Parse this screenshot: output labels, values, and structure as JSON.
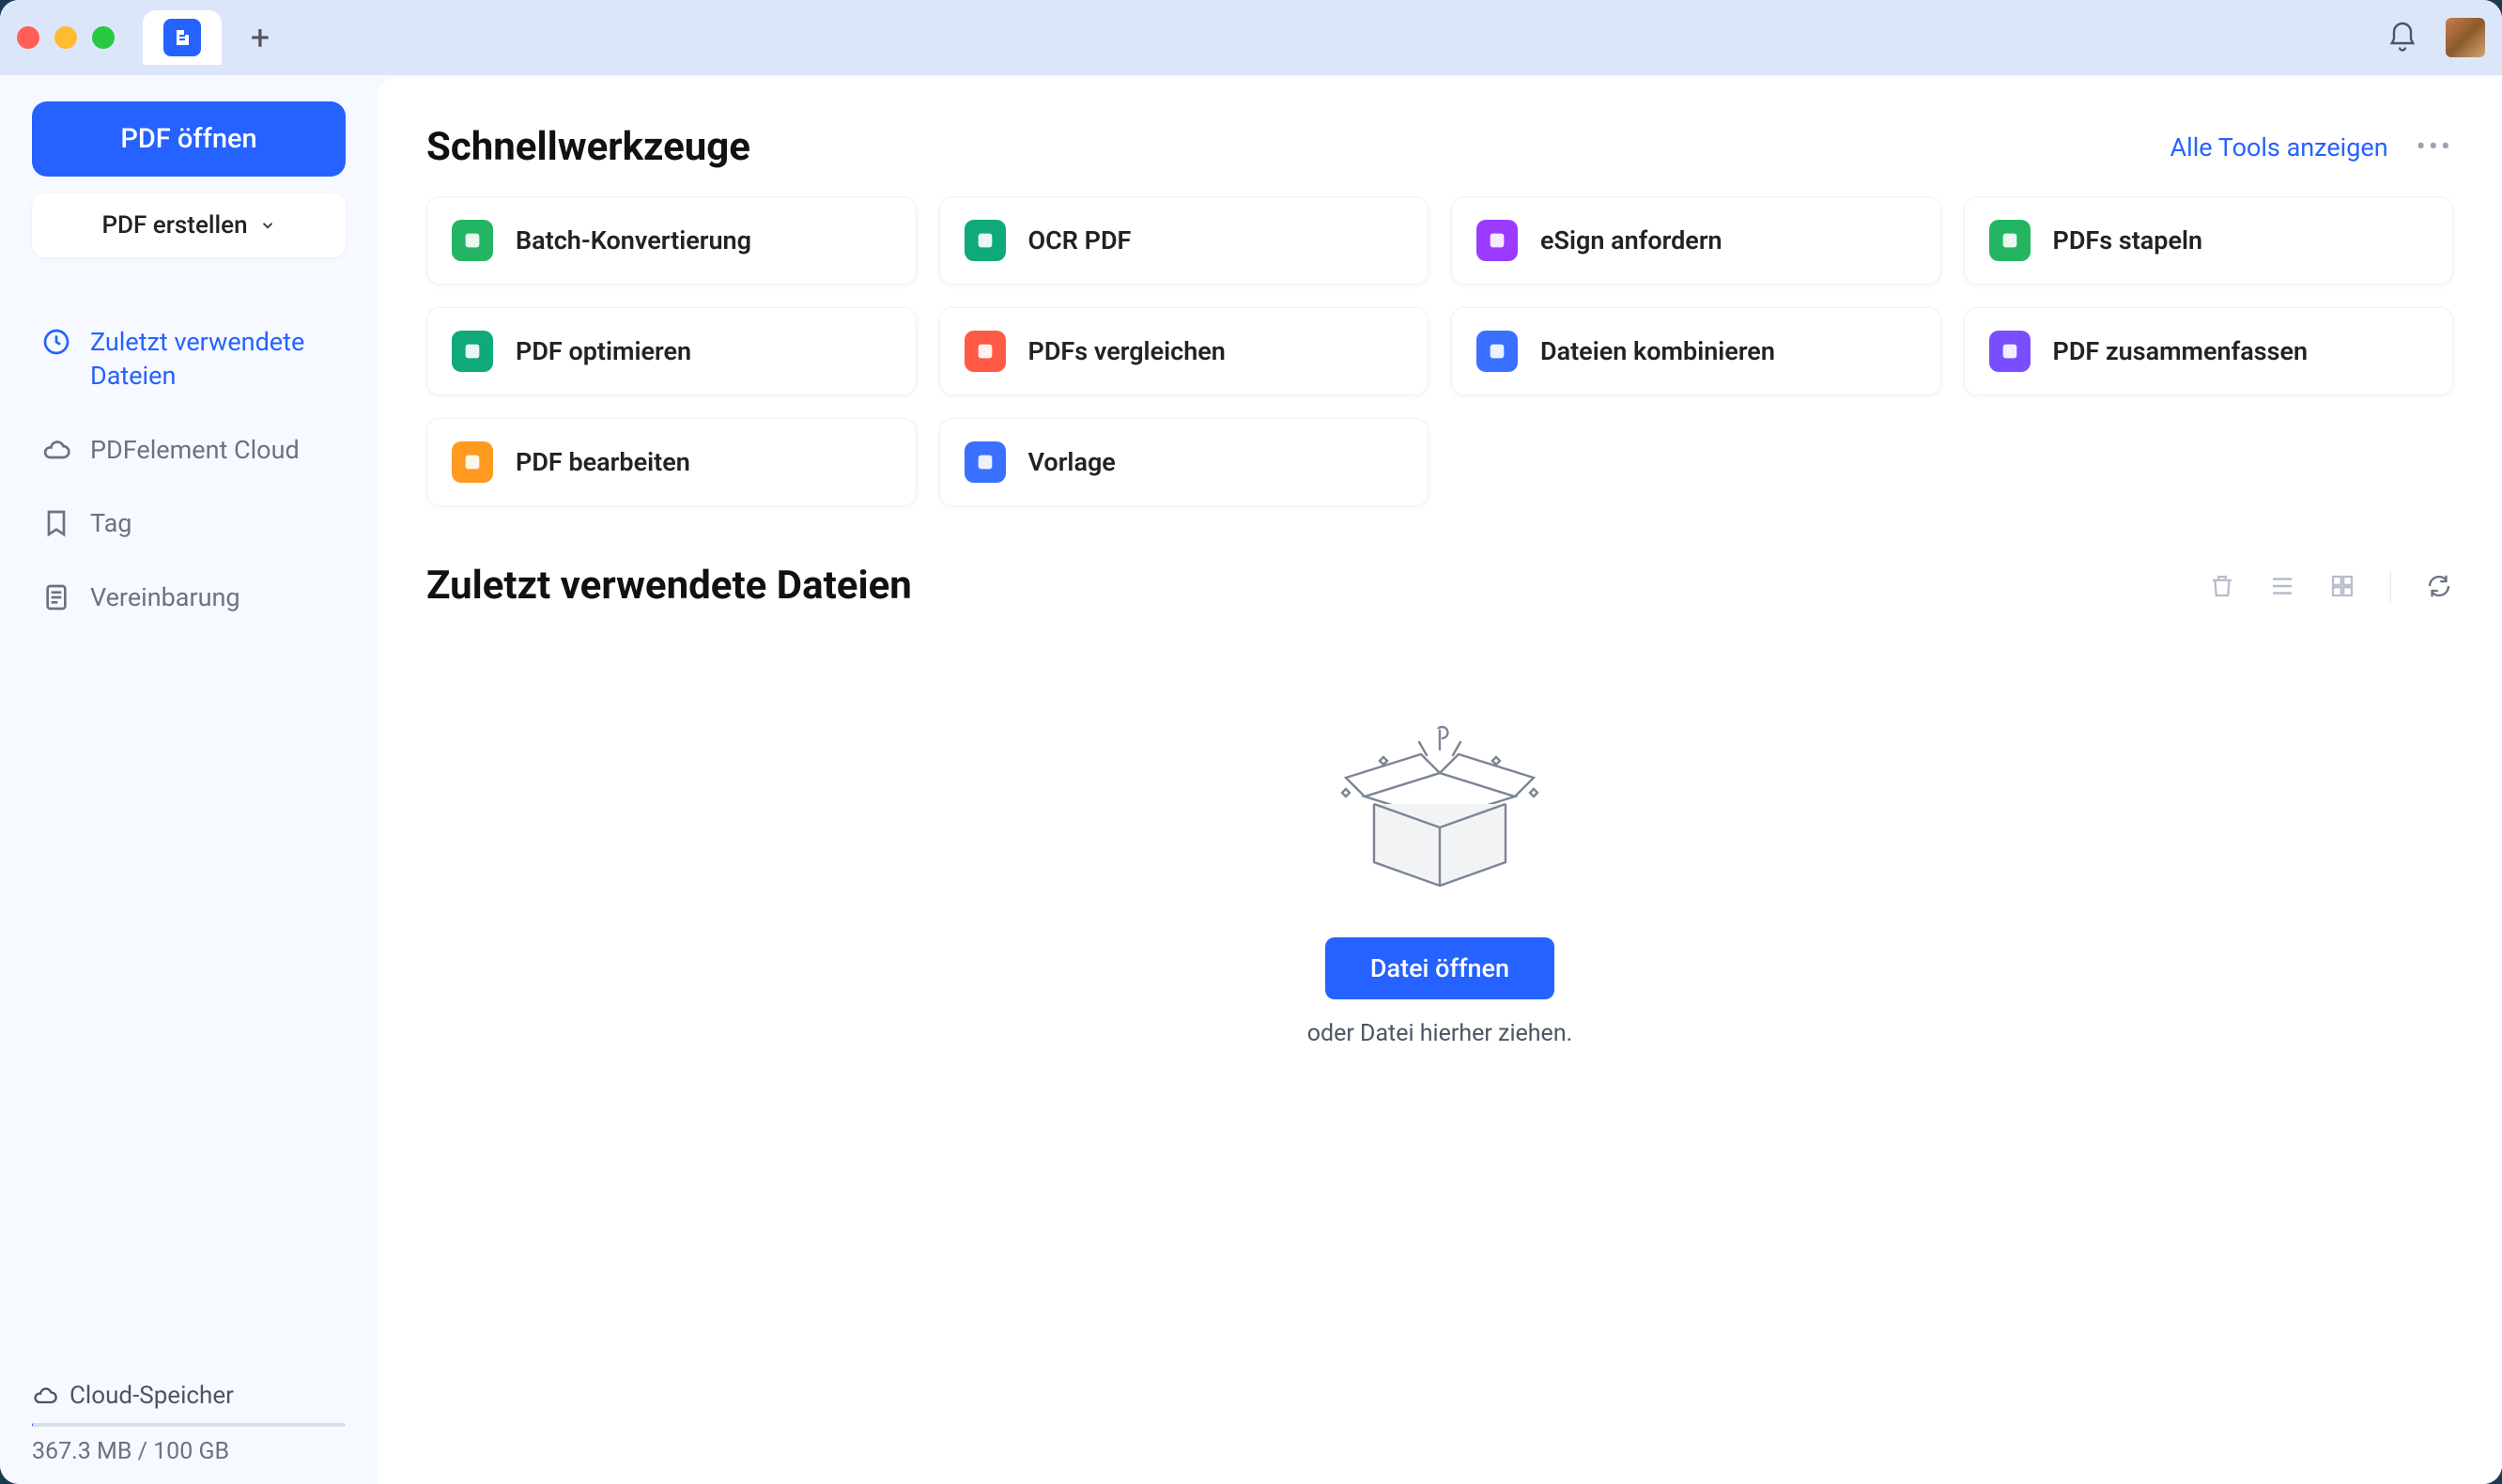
{
  "sidebar": {
    "open_label": "PDF öffnen",
    "create_label": "PDF erstellen",
    "nav": [
      {
        "label": "Zuletzt verwendete Dateien",
        "icon": "clock-icon",
        "active": true
      },
      {
        "label": "PDFelement Cloud",
        "icon": "cloud-icon",
        "active": false
      },
      {
        "label": "Tag",
        "icon": "bookmark-icon",
        "active": false
      },
      {
        "label": "Vereinbarung",
        "icon": "document-icon",
        "active": false
      }
    ],
    "storage_label": "Cloud-Speicher",
    "storage_usage": "367.3 MB / 100 GB"
  },
  "quicktools": {
    "title": "Schnellwerkzeuge",
    "show_all": "Alle Tools anzeigen",
    "tools": [
      {
        "label": "Batch-Konvertierung",
        "icon": "batch-convert-icon",
        "bg": "#e6f7ea",
        "fg": "#24b562"
      },
      {
        "label": "OCR PDF",
        "icon": "ocr-icon",
        "bg": "#d5f1e8",
        "fg": "#0fa97a"
      },
      {
        "label": "eSign anfordern",
        "icon": "esign-icon",
        "bg": "#f0e0ff",
        "fg": "#9b3bff"
      },
      {
        "label": "PDFs stapeln",
        "icon": "stack-icon",
        "bg": "#e6f7ea",
        "fg": "#24b562"
      },
      {
        "label": "PDF optimieren",
        "icon": "optimize-icon",
        "bg": "#d5f1e8",
        "fg": "#0fa97a"
      },
      {
        "label": "PDFs vergleichen",
        "icon": "compare-icon",
        "bg": "#ffe1de",
        "fg": "#ff5a46"
      },
      {
        "label": "Dateien kombinieren",
        "icon": "combine-icon",
        "bg": "#dde7ff",
        "fg": "#3a70ff"
      },
      {
        "label": "PDF zusammenfassen",
        "icon": "summarize-icon",
        "bg": "#ede2ff",
        "fg": "#7a4dff"
      },
      {
        "label": "PDF bearbeiten",
        "icon": "edit-icon",
        "bg": "#ffe9cc",
        "fg": "#ff9a1f"
      },
      {
        "label": "Vorlage",
        "icon": "template-icon",
        "bg": "#dde7ff",
        "fg": "#3a70ff"
      }
    ]
  },
  "recent": {
    "title": "Zuletzt verwendete Dateien",
    "open_button": "Datei öffnen",
    "hint": "oder Datei hierher ziehen."
  }
}
